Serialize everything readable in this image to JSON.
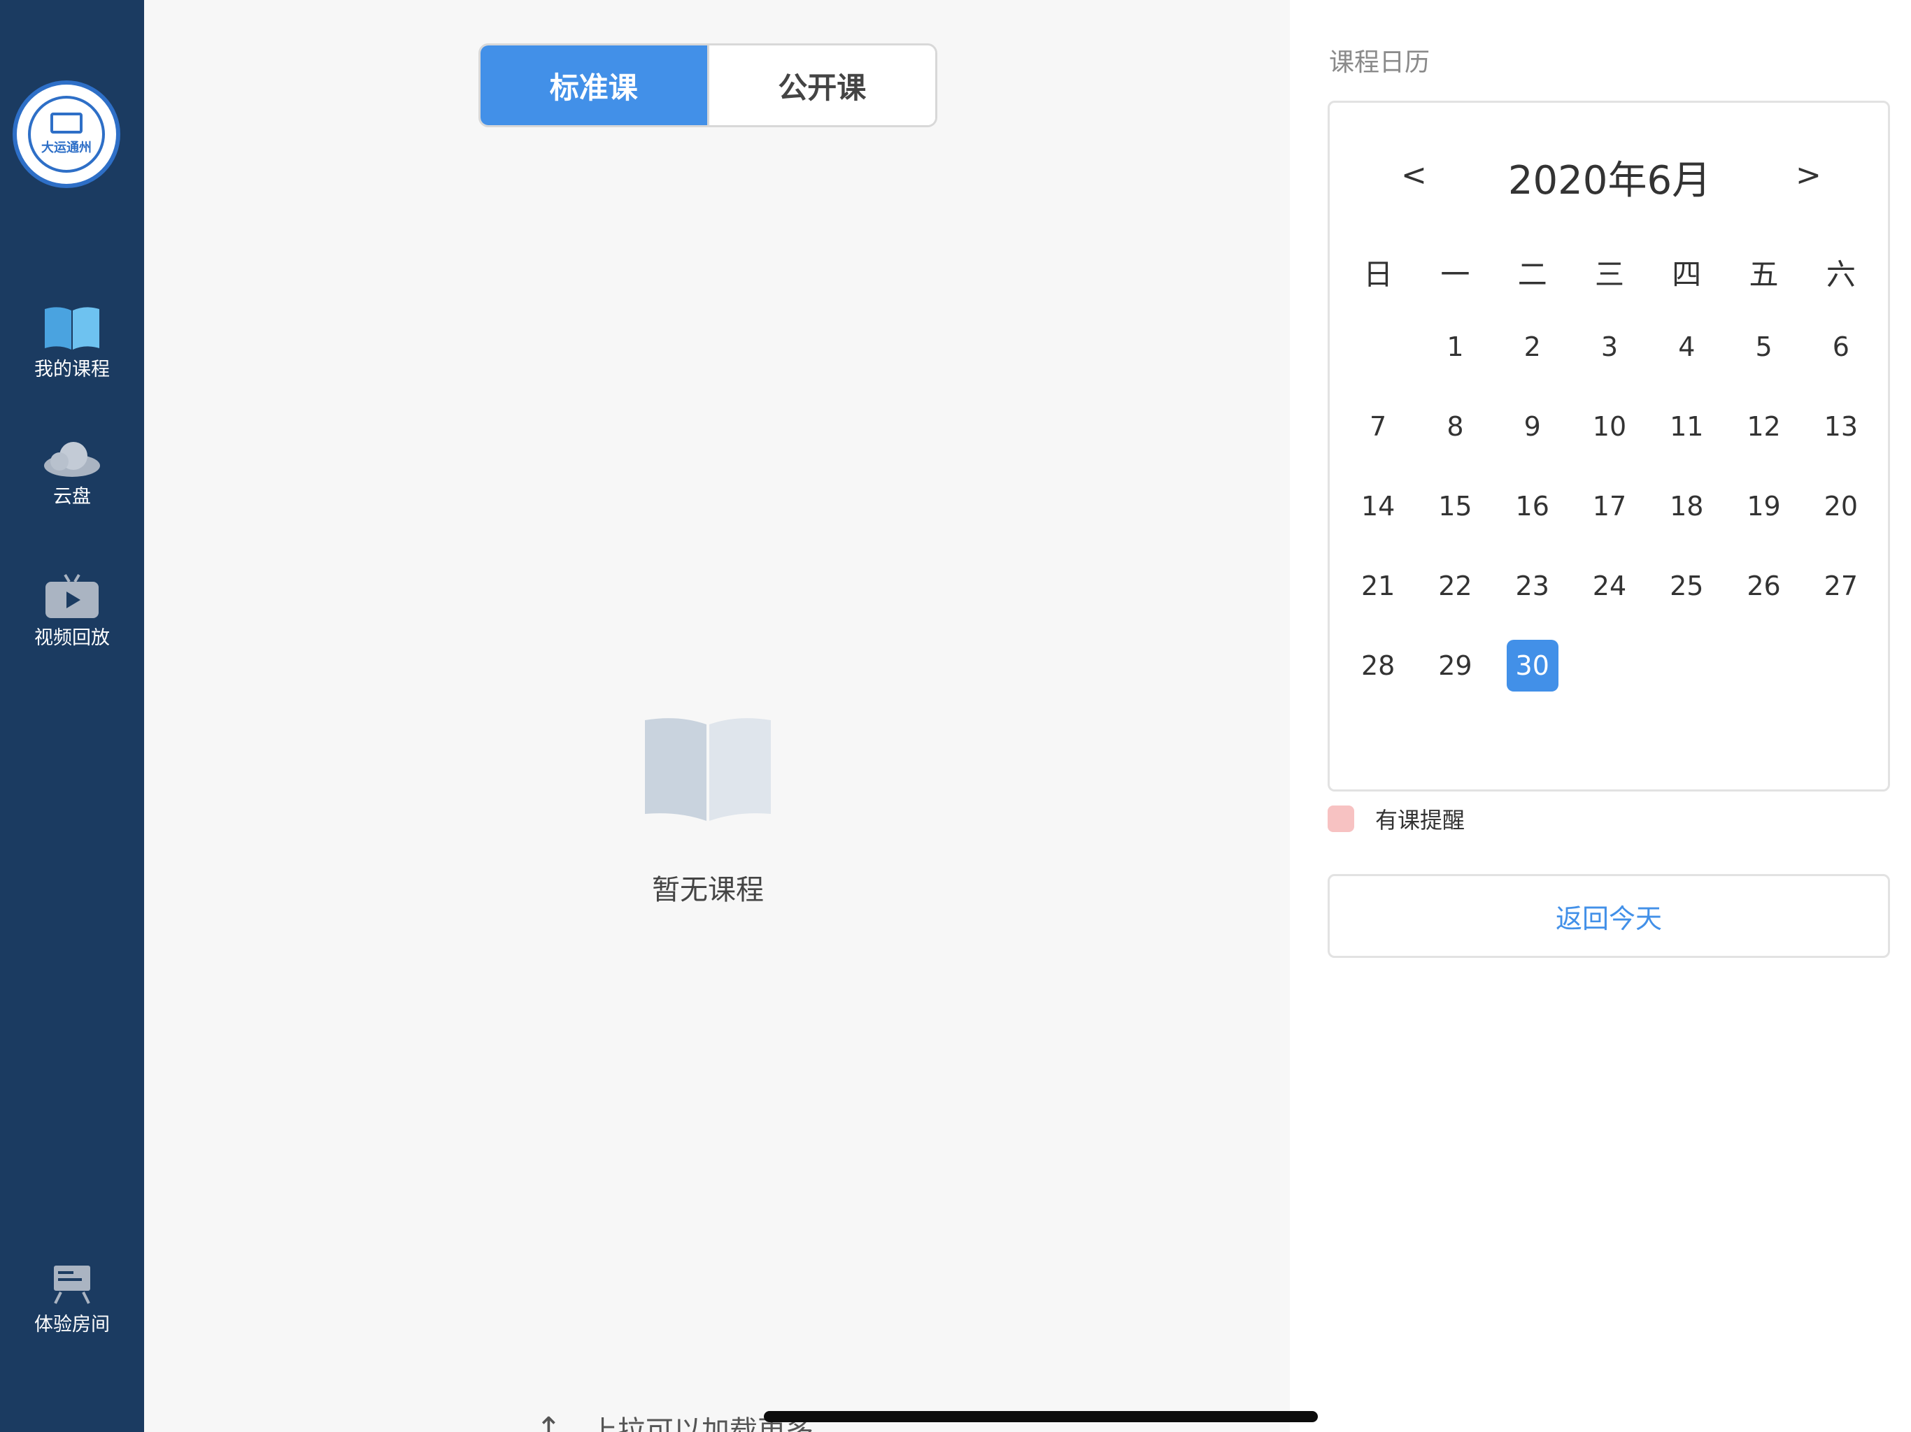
{
  "sidebar": {
    "logo_text": "大运通州",
    "items": [
      {
        "label": "我的课程",
        "icon": "book-icon"
      },
      {
        "label": "云盘",
        "icon": "cloud-icon"
      },
      {
        "label": "视频回放",
        "icon": "tv-play-icon"
      },
      {
        "label": "体验房间",
        "icon": "whiteboard-icon"
      }
    ]
  },
  "main": {
    "tabs": [
      {
        "label": "标准课",
        "selected": true
      },
      {
        "label": "公开课",
        "selected": false
      }
    ],
    "empty_text": "暂无课程",
    "pull_more": "上拉可以加载更多"
  },
  "calendar": {
    "heading": "课程日历",
    "prev": "<",
    "next": ">",
    "title": "2020年6月",
    "weekdays": [
      "日",
      "一",
      "二",
      "三",
      "四",
      "五",
      "六"
    ],
    "first_weekday_index": 1,
    "days": [
      "1",
      "2",
      "3",
      "4",
      "5",
      "6",
      "7",
      "8",
      "9",
      "10",
      "11",
      "12",
      "13",
      "14",
      "15",
      "16",
      "17",
      "18",
      "19",
      "20",
      "21",
      "22",
      "23",
      "24",
      "25",
      "26",
      "27",
      "28",
      "29",
      "30"
    ],
    "selected_day": "30",
    "legend": "有课提醒",
    "back_today": "返回今天"
  },
  "colors": {
    "sidebar_bg": "#1b3b61",
    "accent": "#4290e8",
    "legend_swatch": "#f7c2c2"
  }
}
